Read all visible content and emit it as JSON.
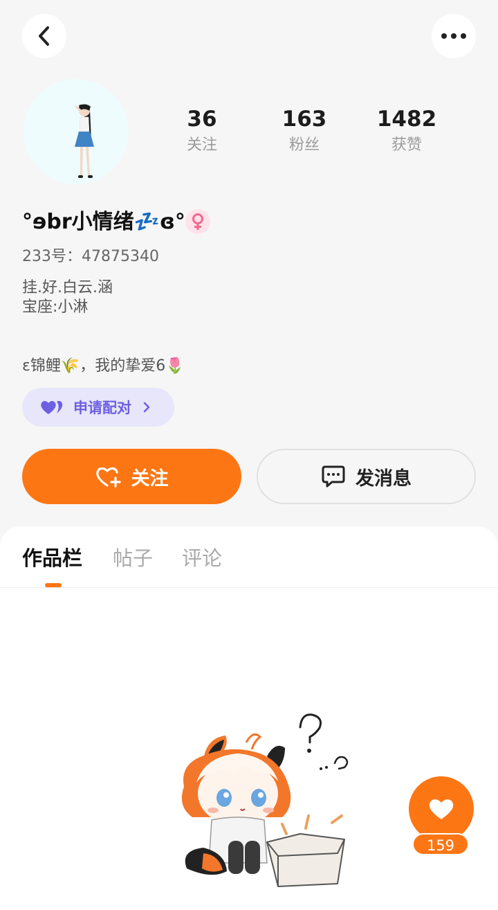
{
  "profile": {
    "nickname": "°ɘbr小情绪💤ɞ°",
    "uid_label": "233号：",
    "uid": "47875340",
    "bio_line1": "挂.好.白云.涵",
    "bio_line2": "宝座:小淋",
    "bio_line3": "ɛ锦鲤🌾，我的挚爱6🌷",
    "gender": "female"
  },
  "stats": [
    {
      "value": "36",
      "label": "关注"
    },
    {
      "value": "163",
      "label": "粉丝"
    },
    {
      "value": "1482",
      "label": "获赞"
    }
  ],
  "actions": {
    "pair_label": "申请配对",
    "follow_label": "关注",
    "message_label": "发消息"
  },
  "tabs": [
    {
      "label": "作品栏",
      "active": true
    },
    {
      "label": "帖子",
      "active": false
    },
    {
      "label": "评论",
      "active": false
    }
  ],
  "like_count": "159",
  "colors": {
    "accent": "#fd7614",
    "pair_bg": "#e7e6fb",
    "pair_text": "#6d5fe2",
    "gender_bg": "#ffe2ea",
    "gender_icon": "#f06a8e"
  },
  "icons": [
    "back-icon",
    "more-icon",
    "female-icon",
    "couple-hearts-icon",
    "chevron-right-icon",
    "heart-plus-icon",
    "chat-bubble-icon",
    "heart-icon"
  ]
}
